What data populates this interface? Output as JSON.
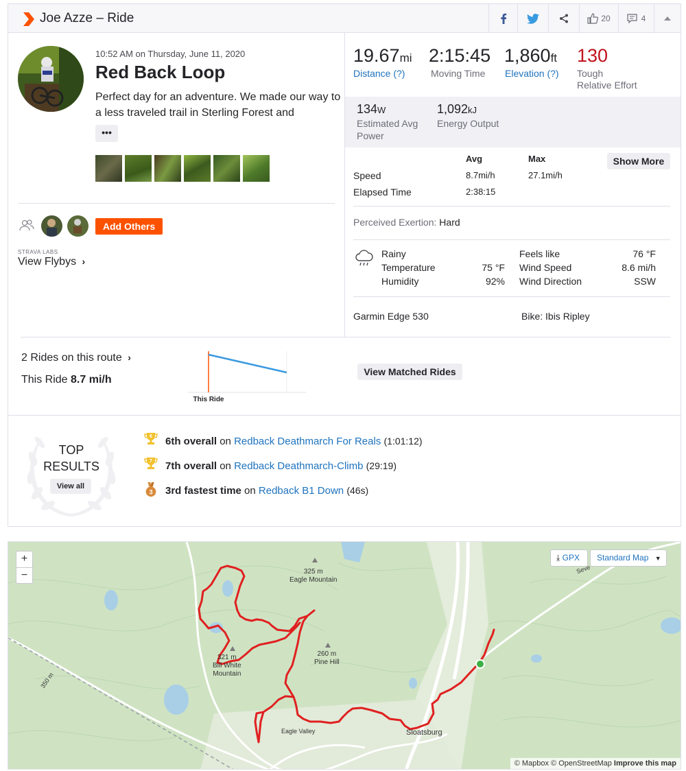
{
  "header": {
    "title": "Joe Azze – Ride",
    "kudos_count": "20",
    "comment_count": "4"
  },
  "activity": {
    "datetime": "10:52 AM on Thursday, June 11, 2020",
    "name": "Red Back Loop",
    "description": "Perfect day for an adventure. We made our way to a less traveled trail in Sterling Forest and",
    "more_label": "•••",
    "add_others_label": "Add Others",
    "labs_label": "STRAVA LABS",
    "flybys_label": "View Flybys"
  },
  "stats": {
    "distance": {
      "value": "19.67",
      "unit": "mi",
      "label": "Distance (?)"
    },
    "moving_time": {
      "value": "2:15:45",
      "label": "Moving Time"
    },
    "elevation": {
      "value": "1,860",
      "unit": "ft",
      "label": "Elevation (?)"
    },
    "relative_effort": {
      "value": "130",
      "label1": "Tough",
      "label2": "Relative Effort"
    },
    "power": {
      "value": "134",
      "unit": "W",
      "label1": "Estimated Avg",
      "label2": "Power"
    },
    "energy": {
      "value": "1,092",
      "unit": "kJ",
      "label": "Energy Output"
    }
  },
  "table": {
    "col_avg": "Avg",
    "col_max": "Max",
    "show_more": "Show More",
    "rows": [
      {
        "label": "Speed",
        "avg": "8.7mi/h",
        "max": "27.1mi/h"
      },
      {
        "label": "Elapsed Time",
        "avg": "2:38:15",
        "max": ""
      }
    ]
  },
  "perceived": {
    "label": "Perceived Exertion:",
    "value": "Hard"
  },
  "weather": {
    "condition": "Rainy",
    "temperature_label": "Temperature",
    "temperature": "75 °F",
    "humidity_label": "Humidity",
    "humidity": "92%",
    "feels_like_label": "Feels like",
    "feels_like": "76 °F",
    "wind_speed_label": "Wind Speed",
    "wind_speed": "8.6 mi/h",
    "wind_dir_label": "Wind Direction",
    "wind_dir": "SSW"
  },
  "gear": {
    "device": "Garmin Edge 530",
    "bike": "Bike: Ibis Ripley"
  },
  "rides": {
    "count_label": "2 Rides on this route",
    "this_ride_label": "This Ride",
    "this_ride_speed": "8.7 mi/h",
    "chart_marker_label": "This Ride",
    "view_matched": "View Matched Rides"
  },
  "top_results": {
    "title_line1": "TOP",
    "title_line2": "RESULTS",
    "view_all": "View all",
    "items": [
      {
        "badge": "6",
        "rank": "6th overall",
        "on": "on",
        "segment": "Redback Deathmarch For Reals",
        "time": "(1:01:12)",
        "color": "#f2c12e"
      },
      {
        "badge": "7",
        "rank": "7th overall",
        "on": "on",
        "segment": "Redback Deathmarch-Climb",
        "time": "(29:19)",
        "color": "#f2c12e"
      },
      {
        "badge": "3",
        "rank": "3rd fastest time",
        "on": "on",
        "segment": "Redback B1 Down",
        "time": "(46s)",
        "color": "#d88a3a"
      }
    ]
  },
  "map": {
    "zoom_in": "+",
    "zoom_out": "−",
    "gpx_label": "GPX",
    "map_type": "Standard Map",
    "labels": {
      "eagle_elev": "325 m",
      "eagle_name": "Eagle Mountain",
      "bill_elev": "321 m",
      "bill_name1": "Bill White",
      "bill_name2": "Mountain",
      "pine_elev": "260 m",
      "pine_name": "Pine Hill",
      "eagle_valley": "Eagle Valley",
      "sloatsburg": "Sloatsburg",
      "contour": "350 m",
      "road": "Seve"
    },
    "attribution_prefix": "© Mapbox © OpenStreetMap",
    "attribution_link": "Improve this map"
  },
  "colors": {
    "brand": "#fc5200",
    "link": "#1e73be",
    "route": "#e02020",
    "effort": "#c0141c"
  }
}
